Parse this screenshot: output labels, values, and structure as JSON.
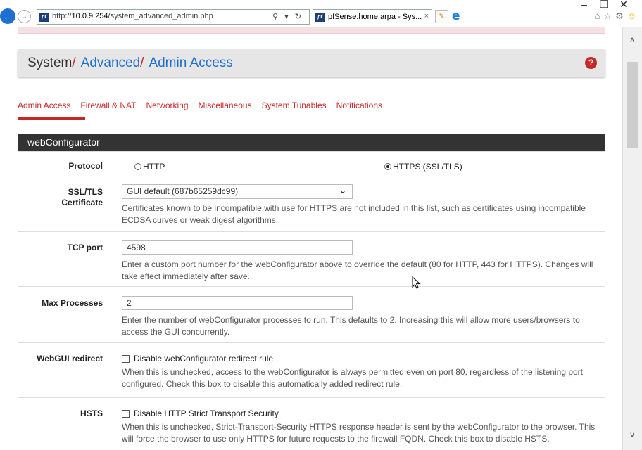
{
  "browser": {
    "url_prefix": "http://",
    "url_host": "10.0.9.254",
    "url_path": "/system_advanced_admin.php",
    "address_icons": "⚲ ▾ ↻",
    "tab_title": "pfSense.home.arpa - Sys...",
    "tab_close": "×",
    "back_glyph": "←",
    "forward_glyph": "→",
    "favicon_glyph": "pf",
    "new_tab_glyph": "✎",
    "ie_glyph": "e",
    "window_controls": {
      "minimize": "–",
      "restore": "❐",
      "close": "✕"
    },
    "toolbar": {
      "home": "⌂",
      "favorites": "☆",
      "settings": "⚙",
      "feedback": "☺"
    }
  },
  "header": {
    "crumbs": [
      {
        "label": "System",
        "sep": "/"
      },
      {
        "label": "Advanced",
        "sep": "/"
      },
      {
        "label": "Admin Access"
      }
    ],
    "help_glyph": "?"
  },
  "tabs": [
    {
      "label": "Admin Access",
      "active": true
    },
    {
      "label": "Firewall & NAT"
    },
    {
      "label": "Networking"
    },
    {
      "label": "Miscellaneous"
    },
    {
      "label": "System Tunables"
    },
    {
      "label": "Notifications"
    }
  ],
  "panel": {
    "title": "webConfigurator",
    "protocol": {
      "label": "Protocol",
      "options": [
        {
          "label": "HTTP",
          "selected": false
        },
        {
          "label": "HTTPS (SSL/TLS)",
          "selected": true
        }
      ]
    },
    "ssl_cert": {
      "label_line1": "SSL/TLS",
      "label_line2": "Certificate",
      "selected": "GUI default (687b65259dc99)",
      "help": "Certificates known to be incompatible with use for HTTPS are not included in this list, such as certificates using incompatible ECDSA curves or weak digest algorithms."
    },
    "tcp_port": {
      "label": "TCP port",
      "value": "4598",
      "help": "Enter a custom port number for the webConfigurator above to override the default (80 for HTTP, 443 for HTTPS). Changes will take effect immediately after save."
    },
    "max_processes": {
      "label": "Max Processes",
      "value": "2",
      "help": "Enter the number of webConfigurator processes to run. This defaults to 2. Increasing this will allow more users/browsers to access the GUI concurrently."
    },
    "webgui_redirect": {
      "label": "WebGUI redirect",
      "checkbox_label": "Disable webConfigurator redirect rule",
      "checked": false,
      "help": "When this is unchecked, access to the webConfigurator is always permitted even on port 80, regardless of the listening port configured. Check this box to disable this automatically added redirect rule."
    },
    "hsts": {
      "label": "HSTS",
      "checkbox_label": "Disable HTTP Strict Transport Security",
      "checked": false,
      "help": "When this is unchecked, Strict-Transport-Security HTTPS response header is sent by the webConfigurator to the browser. This will force the browser to use only HTTPS for future requests to the firewall FQDN. Check this box to disable HSTS."
    }
  },
  "scrollbar": {
    "up_glyph": "∧",
    "down_glyph": "∨"
  },
  "colors": {
    "link": "#1e6fd0",
    "accent_red": "#c62828",
    "panel_heading": "#333333"
  }
}
